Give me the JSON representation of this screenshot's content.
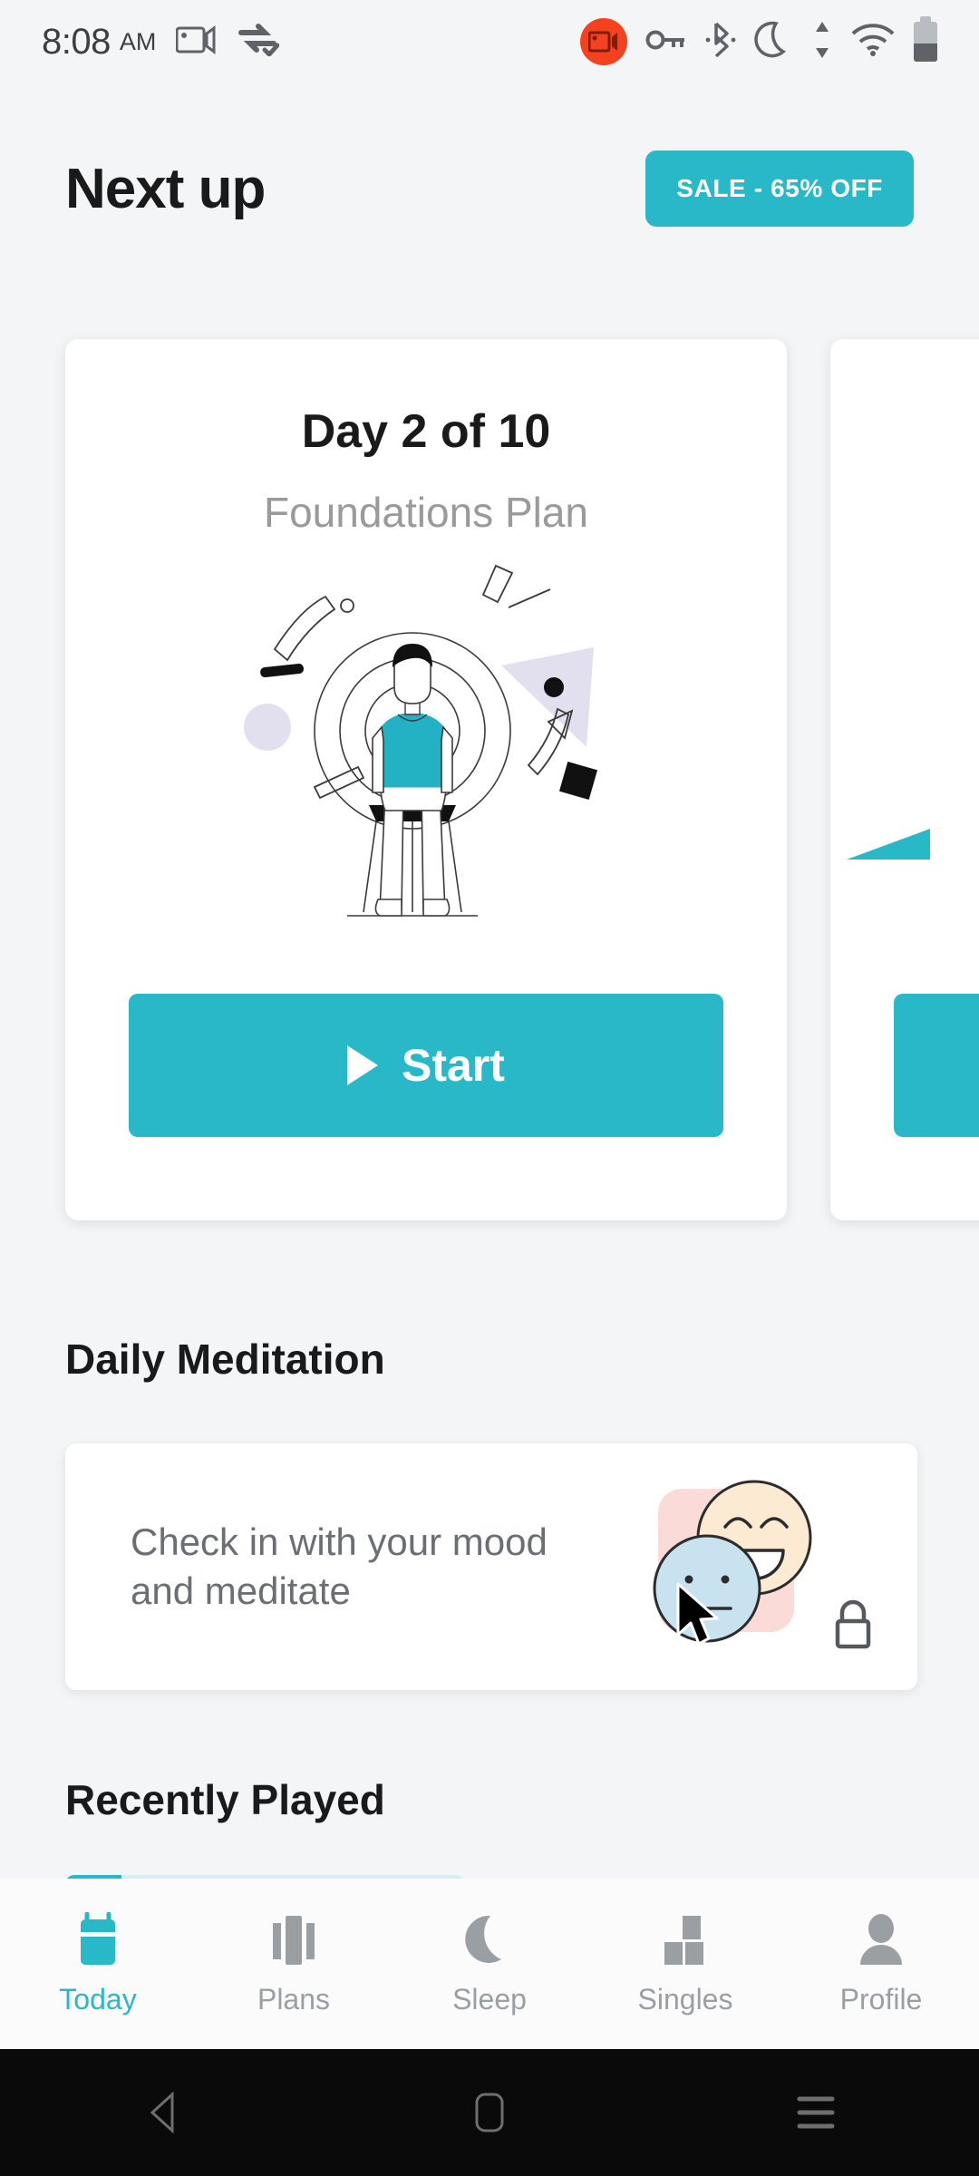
{
  "status_bar": {
    "time": "8:08",
    "ampm": "AM",
    "icons": [
      "screen-record-icon",
      "data-saver-icon",
      "screen-record-active-icon",
      "vpn-key-icon",
      "bluetooth-icon",
      "do-not-disturb-moon-icon",
      "data-transfer-icon",
      "wifi-icon",
      "battery-icon"
    ]
  },
  "header": {
    "title": "Next up",
    "sale_label": "SALE - 65% OFF"
  },
  "plan_card": {
    "day_label": "Day 2 of 10",
    "plan_name": "Foundations Plan",
    "start_label": "Start",
    "illustration": "person-meditating-on-stool-illustration"
  },
  "daily_meditation": {
    "section_title": "Daily Meditation",
    "card_text": "Check in with your mood and meditate",
    "art": "happy-and-neutral-faces-illustration",
    "lock": "lock-icon"
  },
  "recently_played": {
    "section_title": "Recently Played"
  },
  "tabs": [
    {
      "label": "Today",
      "icon": "calendar-icon",
      "active": true
    },
    {
      "label": "Plans",
      "icon": "columns-icon",
      "active": false
    },
    {
      "label": "Sleep",
      "icon": "moon-icon",
      "active": false
    },
    {
      "label": "Singles",
      "icon": "blocks-icon",
      "active": false
    },
    {
      "label": "Profile",
      "icon": "person-icon",
      "active": false
    }
  ],
  "android_nav": [
    "back-icon",
    "home-icon",
    "recents-icon"
  ],
  "colors": {
    "accent": "#29b8c8",
    "background": "#f4f5f7",
    "card": "#ffffff",
    "muted_text": "#9a9a9a",
    "body_text": "#6b6f73",
    "title_text": "#1a1a1a",
    "record_red": "#f4421e",
    "mood_pink": "#fadbd8",
    "mood_cream": "#fcebd2",
    "mood_blue": "#c8e2ef",
    "lavender": "#e0e0ef"
  }
}
